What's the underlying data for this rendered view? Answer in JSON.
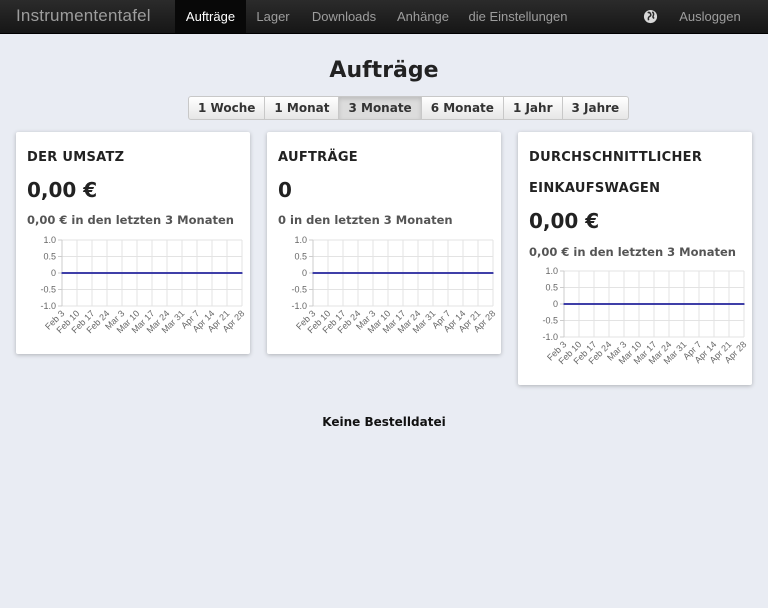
{
  "navbar": {
    "brand": "Instrumententafel",
    "items": [
      {
        "label": "Aufträge",
        "active": true
      },
      {
        "label": "Lager",
        "active": false
      },
      {
        "label": "Downloads",
        "active": false
      },
      {
        "label": "Anhänge",
        "active": false
      },
      {
        "label": "die Einstellungen",
        "active": false
      }
    ],
    "language_icon": "globe-icon",
    "logout": "Ausloggen"
  },
  "page": {
    "title": "Aufträge",
    "ranges": [
      "1 Woche",
      "1 Monat",
      "3 Monate",
      "6 Monate",
      "1 Jahr",
      "3 Jahre"
    ],
    "active_range": "3 Monate",
    "empty_message": "Keine Bestelldatei"
  },
  "cards": [
    {
      "title": "DER UMSATZ",
      "value": "0,00 €",
      "subtitle": "0,00 € in den letzten 3 Monaten"
    },
    {
      "title": "AUFTRÄGE",
      "value": "0",
      "subtitle": "0 in den letzten 3 Monaten"
    },
    {
      "title_line1": "DURCHSCHNITTLICHER",
      "title_line2": "EINKAUFSWAGEN",
      "value": "0,00 €",
      "subtitle": "0,00 € in den letzten 3 Monaten"
    }
  ],
  "chart_data": [
    {
      "type": "line",
      "x": [
        "Feb 3",
        "Feb 10",
        "Feb 17",
        "Feb 24",
        "Mar 3",
        "Mar 10",
        "Mar 17",
        "Mar 24",
        "Mar 31",
        "Apr 7",
        "Apr 14",
        "Apr 21",
        "Apr 28"
      ],
      "y": [
        0,
        0,
        0,
        0,
        0,
        0,
        0,
        0,
        0,
        0,
        0,
        0,
        0
      ],
      "yticks": [
        "1.0",
        "0.5",
        "0",
        "-0.5",
        "-1.0"
      ],
      "ylim": [
        -1.0,
        1.0
      ],
      "grid": true,
      "line_color": "#3f3fa8"
    },
    {
      "type": "line",
      "x": [
        "Feb 3",
        "Feb 10",
        "Feb 17",
        "Feb 24",
        "Mar 3",
        "Mar 10",
        "Mar 17",
        "Mar 24",
        "Mar 31",
        "Apr 7",
        "Apr 14",
        "Apr 21",
        "Apr 28"
      ],
      "y": [
        0,
        0,
        0,
        0,
        0,
        0,
        0,
        0,
        0,
        0,
        0,
        0,
        0
      ],
      "yticks": [
        "1.0",
        "0.5",
        "0",
        "-0.5",
        "-1.0"
      ],
      "ylim": [
        -1.0,
        1.0
      ],
      "grid": true,
      "line_color": "#3f3fa8"
    },
    {
      "type": "line",
      "x": [
        "Feb 3",
        "Feb 10",
        "Feb 17",
        "Feb 24",
        "Mar 3",
        "Mar 10",
        "Mar 17",
        "Mar 24",
        "Mar 31",
        "Apr 7",
        "Apr 14",
        "Apr 21",
        "Apr 28"
      ],
      "y": [
        0,
        0,
        0,
        0,
        0,
        0,
        0,
        0,
        0,
        0,
        0,
        0,
        0
      ],
      "yticks": [
        "1.0",
        "0.5",
        "0",
        "-0.5",
        "-1.0"
      ],
      "ylim": [
        -1.0,
        1.0
      ],
      "grid": true,
      "line_color": "#3f3fa8"
    }
  ]
}
